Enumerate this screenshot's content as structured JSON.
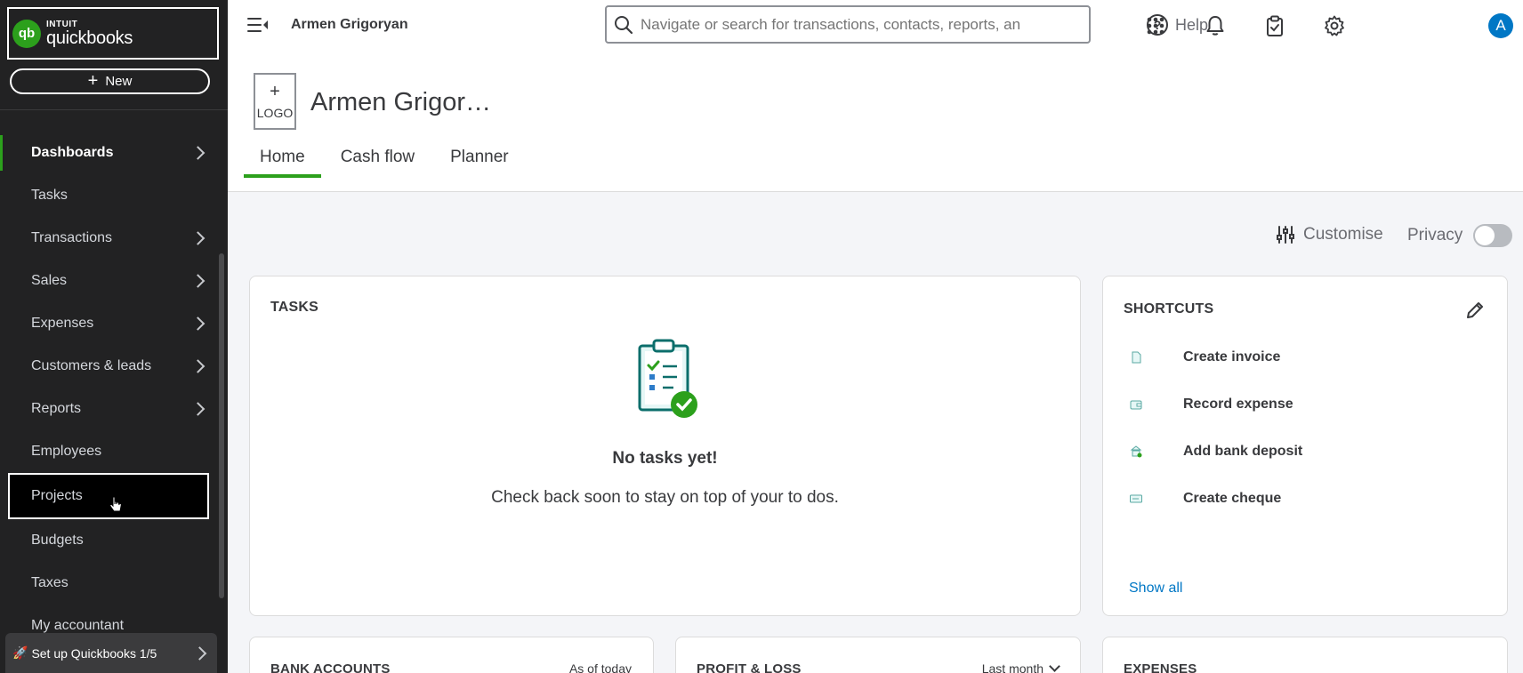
{
  "brand": {
    "intuit": "INTUIT",
    "product": "quickbooks",
    "logo_mark": "qb"
  },
  "sidebar": {
    "new_label": "New",
    "items": [
      {
        "label": "Dashboards"
      },
      {
        "label": "Tasks"
      },
      {
        "label": "Transactions"
      },
      {
        "label": "Sales"
      },
      {
        "label": "Expenses"
      },
      {
        "label": "Customers & leads"
      },
      {
        "label": "Reports"
      },
      {
        "label": "Employees"
      },
      {
        "label": "Projects"
      },
      {
        "label": "Budgets"
      },
      {
        "label": "Taxes"
      },
      {
        "label": "My accountant"
      }
    ],
    "setup_label": "Set up Quickbooks 1/5"
  },
  "topbar": {
    "company": "Armen Grigoryan",
    "search_placeholder": "Navigate or search for transactions, contacts, reports, an",
    "help_label": "Help",
    "avatar_initial": "A"
  },
  "header": {
    "logo_plus": "+",
    "logo_label": "LOGO",
    "company_name": "Armen Grigor…",
    "tabs": [
      {
        "label": "Home"
      },
      {
        "label": "Cash flow"
      },
      {
        "label": "Planner"
      }
    ]
  },
  "controls": {
    "customise_label": "Customise",
    "privacy_label": "Privacy"
  },
  "tasks": {
    "title": "TASKS",
    "empty_title": "No tasks yet!",
    "empty_subtitle": "Check back soon to stay on top of your to dos."
  },
  "shortcuts": {
    "title": "SHORTCUTS",
    "items": [
      {
        "label": "Create invoice",
        "icon": "invoice-icon"
      },
      {
        "label": "Record expense",
        "icon": "expense-icon"
      },
      {
        "label": "Add bank deposit",
        "icon": "deposit-icon"
      },
      {
        "label": "Create cheque",
        "icon": "cheque-icon"
      }
    ],
    "show_all": "Show all"
  },
  "bottom_cards": {
    "bank": {
      "title": "BANK ACCOUNTS",
      "right": "As of today"
    },
    "pl": {
      "title": "PROFIT & LOSS",
      "right": "Last month"
    },
    "expenses": {
      "title": "EXPENSES"
    }
  },
  "colors": {
    "accent": "#2ca01c",
    "link": "#0077c5",
    "sidebar_bg": "#222223"
  }
}
